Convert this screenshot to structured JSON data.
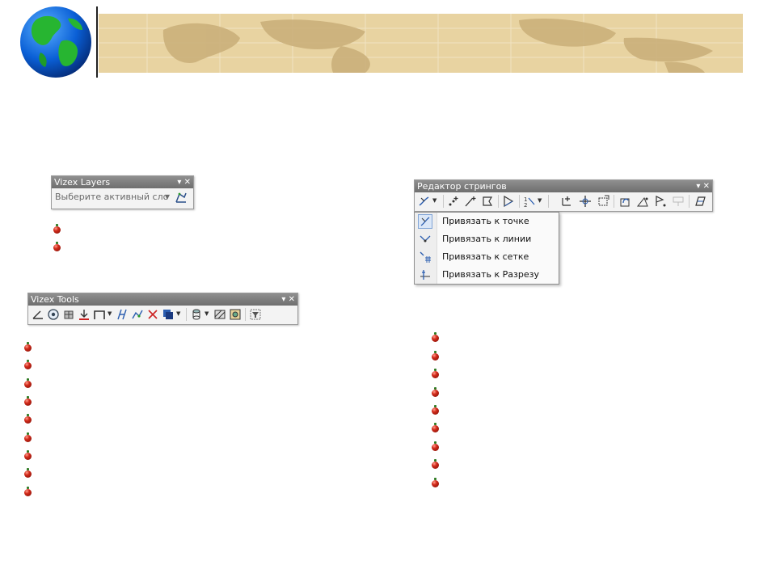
{
  "toolbars": {
    "layers": {
      "title": "Vizex Layers",
      "combo_value": "Выберите активный сло",
      "controls": "▾ ✕"
    },
    "tools": {
      "title": "Vizex Tools",
      "controls": "▾ ✕"
    },
    "string_editor": {
      "title": "Редактор стрингов",
      "controls": "▾ ✕"
    }
  },
  "snap_menu": {
    "items": [
      {
        "label": "Привязать к точке",
        "icon": "snap-point-icon",
        "selected": true
      },
      {
        "label": "Привязать к линии",
        "icon": "snap-line-icon",
        "selected": false
      },
      {
        "label": "Привязать к сетке",
        "icon": "snap-grid-icon",
        "selected": false
      },
      {
        "label": "Привязать к Разрезу",
        "icon": "snap-section-icon",
        "selected": false
      }
    ]
  },
  "bullet_color": "#d22a1a",
  "map_color": "#e8d3a1"
}
